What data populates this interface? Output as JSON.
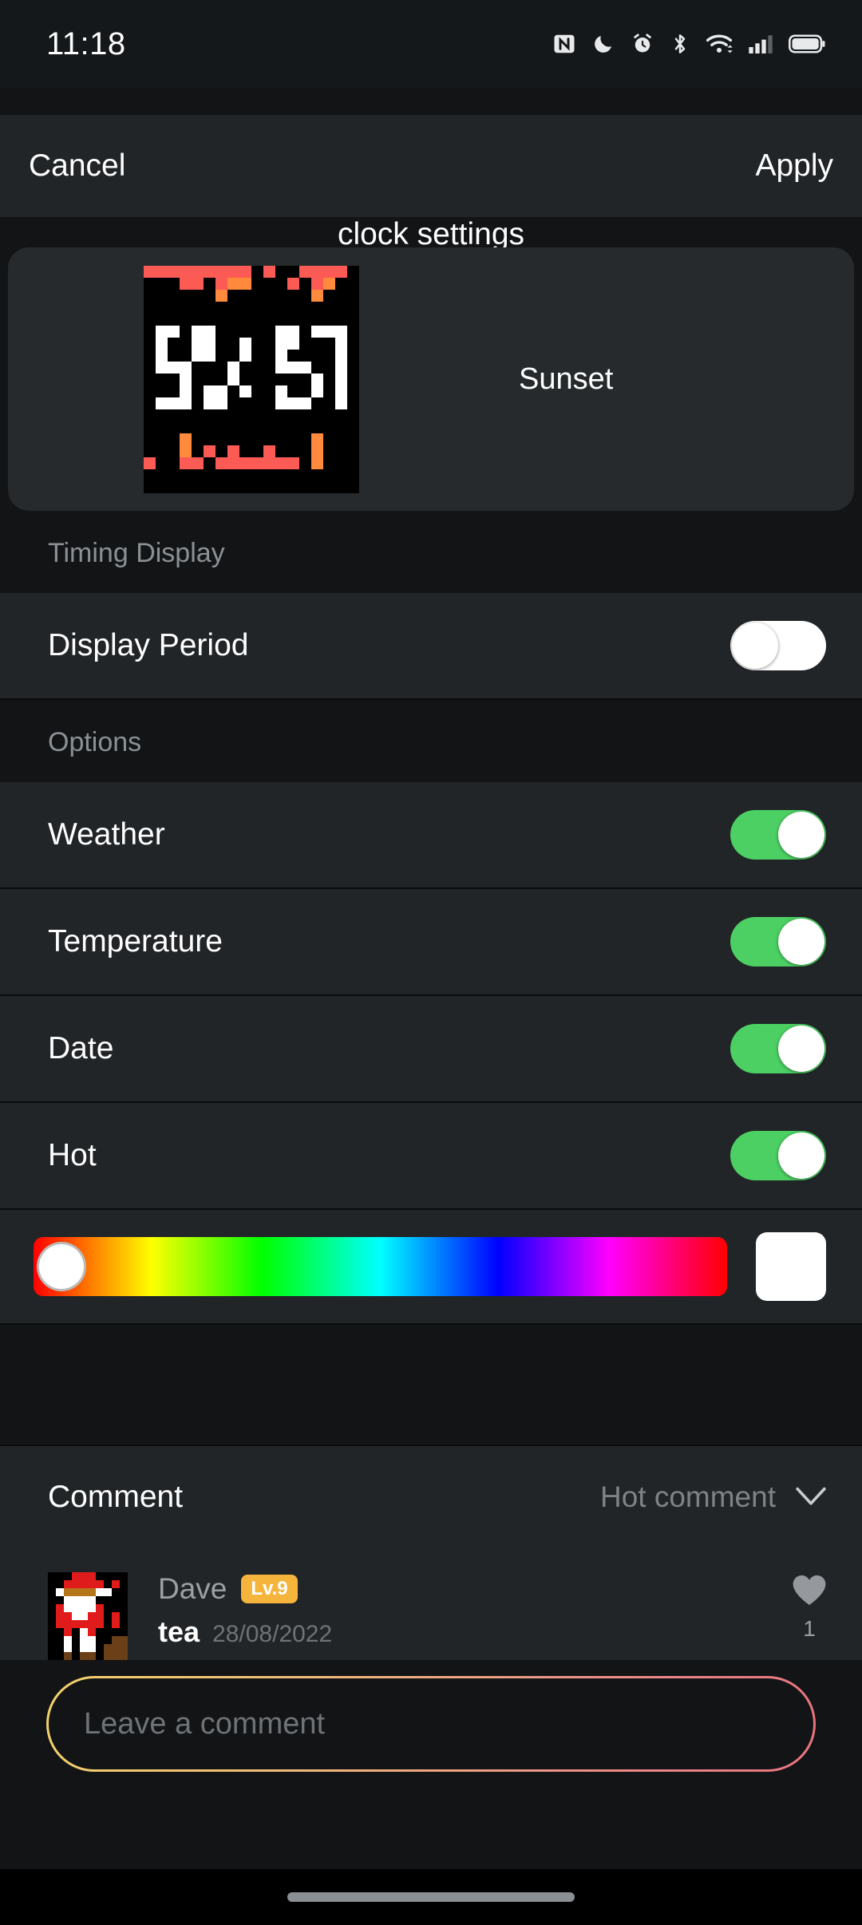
{
  "status_bar": {
    "time": "11:18",
    "icons": [
      "nfc-icon",
      "do-not-disturb-icon",
      "alarm-icon",
      "bluetooth-icon",
      "wifi-icon",
      "cellular-signal-icon",
      "battery-icon"
    ]
  },
  "nav": {
    "cancel": "Cancel",
    "title": "clock settings",
    "apply": "Apply"
  },
  "preview": {
    "clock_time": "24:57",
    "theme_name": "Sunset",
    "colors": {
      "red": "#fb5a55",
      "orange": "#ff8a3d",
      "white": "#ffffff",
      "black": "#000000"
    }
  },
  "timing_section": {
    "header": "Timing Display",
    "rows": [
      {
        "label": "Display Period",
        "state": "off"
      }
    ]
  },
  "options_section": {
    "header": "Options",
    "rows": [
      {
        "label": "Weather",
        "state": "on"
      },
      {
        "label": "Temperature",
        "state": "on"
      },
      {
        "label": "Date",
        "state": "on"
      },
      {
        "label": "Hot",
        "state": "on"
      }
    ],
    "toggle_on_color": "#4cd063",
    "toggle_off_color": "#ffffff"
  },
  "color_picker": {
    "selected_swatch": "#ffffff",
    "thumb_position_percent": 0
  },
  "comment_section": {
    "title": "Comment",
    "sort_label": "Hot comment",
    "sort_icon": "chevron-down-icon",
    "comments": [
      {
        "author": "Dave",
        "level_badge": "Lv.9",
        "text": "tea",
        "date": "28/08/2022",
        "like_icon": "heart-icon",
        "like_count": "1"
      }
    ]
  },
  "comment_input": {
    "placeholder": "Leave a comment",
    "value": ""
  }
}
